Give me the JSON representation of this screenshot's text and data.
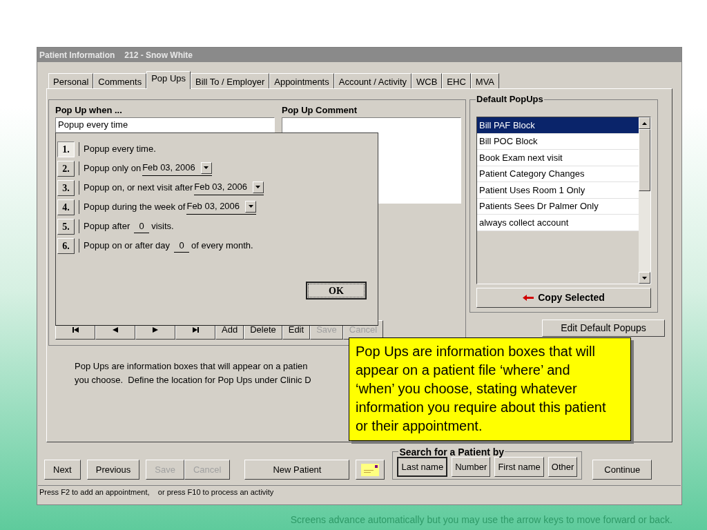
{
  "window": {
    "title": "Patient Information",
    "subtitle": "212 - Snow White"
  },
  "tabs": [
    {
      "label": "Personal",
      "selected": false
    },
    {
      "label": "Comments",
      "selected": false
    },
    {
      "label": "Pop Ups",
      "selected": true
    },
    {
      "label": "Bill To / Employer",
      "selected": false
    },
    {
      "label": "Appointments",
      "selected": false
    },
    {
      "label": "Account / Activity",
      "selected": false
    },
    {
      "label": "WCB",
      "selected": false
    },
    {
      "label": "EHC",
      "selected": false
    },
    {
      "label": "MVA",
      "selected": false
    }
  ],
  "popup_when": {
    "label": "Pop Up when ...",
    "value": "Popup every time"
  },
  "popup_comment": {
    "label": "Pop Up Comment"
  },
  "record_buttons": [
    {
      "label": "Add",
      "disabled": false
    },
    {
      "label": "Delete",
      "disabled": false
    },
    {
      "label": "Edit",
      "disabled": false
    },
    {
      "label": "Save",
      "disabled": true
    },
    {
      "label": "Cancel",
      "disabled": true
    }
  ],
  "description": [
    "Pop Ups are information boxes that will appear on a patien",
    "you choose.  Define the location for Pop Ups under Clinic D"
  ],
  "default_popups": {
    "title": "Default PopUps",
    "items": [
      {
        "label": "Bill PAF Block",
        "selected": true
      },
      {
        "label": "Bill POC Block",
        "selected": false
      },
      {
        "label": "Book Exam next visit",
        "selected": false
      },
      {
        "label": "Patient Category Changes",
        "selected": false
      },
      {
        "label": "Patient Uses Room 1 Only",
        "selected": false
      },
      {
        "label": "Patients Sees Dr Palmer Only",
        "selected": false
      },
      {
        "label": "always collect account",
        "selected": false
      }
    ],
    "copy_button": "Copy Selected"
  },
  "edit_defaults_button": "Edit Default Popups",
  "popup_dialog": {
    "options": [
      {
        "number": "1.",
        "kind": "plain",
        "text": "Popup every time.",
        "selected": true
      },
      {
        "number": "2.",
        "kind": "date",
        "text": "Popup only on",
        "value": "Feb 03, 2006",
        "selected": false
      },
      {
        "number": "3.",
        "kind": "date",
        "text": "Popup on, or next visit after",
        "value": "Feb 03, 2006",
        "selected": false
      },
      {
        "number": "4.",
        "kind": "date",
        "text": "Popup during the week of",
        "value": "Feb 03, 2006",
        "selected": false
      },
      {
        "number": "5.",
        "kind": "count",
        "text": "Popup after",
        "value": "0",
        "suffix": "visits.",
        "selected": false
      },
      {
        "number": "6.",
        "kind": "count",
        "text": "Popup on or after day",
        "value": "0",
        "suffix": "of every month.",
        "selected": false
      }
    ],
    "ok_button": "OK"
  },
  "bottom_buttons": [
    {
      "label": "Next",
      "disabled": false
    },
    {
      "label": "Previous",
      "disabled": false
    },
    {
      "label": "Save",
      "disabled": true
    },
    {
      "label": "Cancel",
      "disabled": true
    },
    {
      "label": "New Patient",
      "disabled": false
    }
  ],
  "search": {
    "title": "Search for a Patient by",
    "buttons": [
      {
        "label": "Last name",
        "selected": true
      },
      {
        "label": "Number",
        "selected": false
      },
      {
        "label": "First name",
        "selected": false
      },
      {
        "label": "Other",
        "selected": false
      }
    ]
  },
  "continue_button": "Continue",
  "status_bar": "Press F2 to add an appointment,    or press F10 to process an activity",
  "callout": "Pop Ups are information boxes that will appear on a patient file ‘where’ and ‘when’ you choose, stating whatever information  you require about this patient or their appointment.",
  "slide_footer": "Screens advance automatically but you may use the arrow keys to move forward or back."
}
